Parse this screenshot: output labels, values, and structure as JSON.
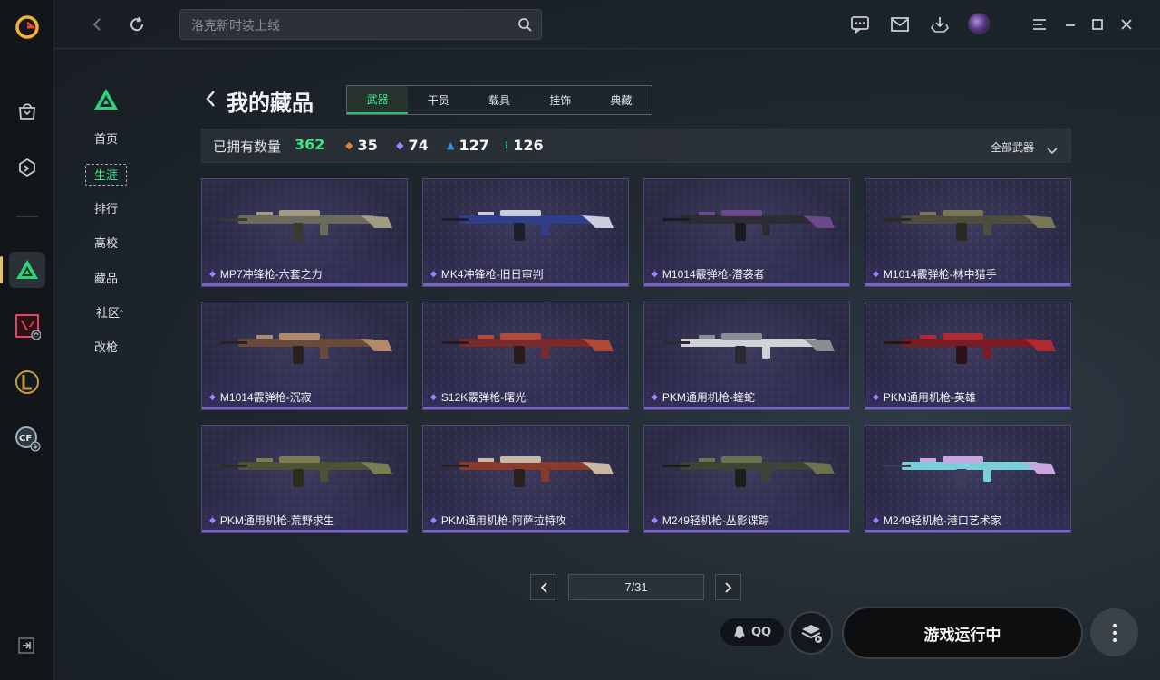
{
  "topbar": {
    "search_placeholder": "洛克新时装上线"
  },
  "rail": {
    "items": [
      {
        "name": "app-logo"
      },
      {
        "name": "store"
      },
      {
        "name": "plugin"
      },
      {
        "name": "delta-force",
        "active": true
      },
      {
        "name": "valorant"
      },
      {
        "name": "league-of-legends"
      },
      {
        "name": "crossfire"
      }
    ]
  },
  "nav": {
    "items": [
      {
        "label": "首页"
      },
      {
        "label": "生涯",
        "active": true
      },
      {
        "label": "排行"
      },
      {
        "label": "高校"
      },
      {
        "label": "藏品"
      },
      {
        "label": "社区",
        "caret": "^"
      },
      {
        "label": "改枪"
      }
    ]
  },
  "header": {
    "title": "我的藏品",
    "tabs": [
      "武器",
      "干员",
      "载具",
      "挂饰",
      "典藏"
    ],
    "active_tab": 0
  },
  "stats": {
    "label": "已拥有数量",
    "total": "362",
    "rarity": [
      {
        "value": "35",
        "color": "#e87a3a"
      },
      {
        "value": "74",
        "color": "#a184ff"
      },
      {
        "value": "127",
        "color": "#3d8fe0"
      },
      {
        "value": "126",
        "color": "#3ee58a"
      }
    ],
    "filter_label": "全部武器"
  },
  "items": [
    {
      "label": "MP7冲锋枪-六套之力",
      "style": "tan"
    },
    {
      "label": "MK4冲锋枪-旧日审判",
      "style": "blue"
    },
    {
      "label": "M1014霰弹枪-潜袭者",
      "style": "dark"
    },
    {
      "label": "M1014霰弹枪-林中猎手",
      "style": "camo"
    },
    {
      "label": "M1014霰弹枪-沉寂",
      "style": "copper"
    },
    {
      "label": "S12K霰弹枪-曙光",
      "style": "red"
    },
    {
      "label": "PKM通用机枪-蝰蛇",
      "style": "white"
    },
    {
      "label": "PKM通用机枪-英雄",
      "style": "crimson"
    },
    {
      "label": "PKM通用机枪-荒野求生",
      "style": "olive"
    },
    {
      "label": "PKM通用机枪-阿萨拉特攻",
      "style": "rust"
    },
    {
      "label": "M249轻机枪-丛影谍踪",
      "style": "forest"
    },
    {
      "label": "M249轻机枪-港口艺术家",
      "style": "pastel"
    }
  ],
  "pager": {
    "text": "7/31"
  },
  "bottom": {
    "qq_label": "QQ",
    "game_status": "游戏运行中"
  }
}
